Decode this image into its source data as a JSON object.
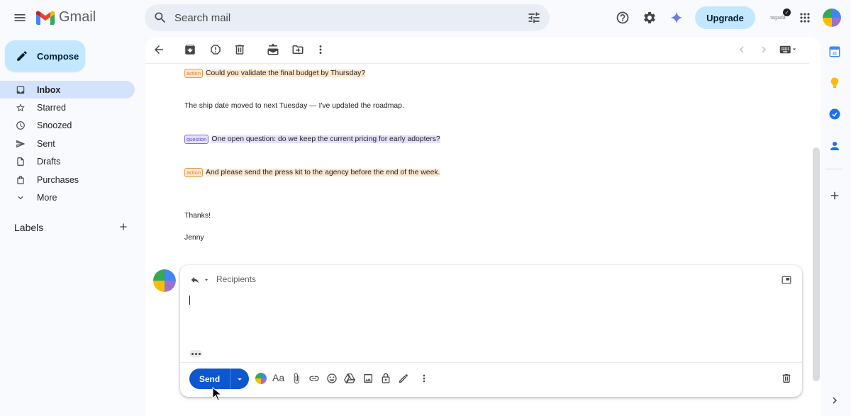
{
  "header": {
    "app_name": "Gmail",
    "search_placeholder": "Search mail",
    "upgrade_label": "Upgrade",
    "account_label": "tagada",
    "account_badge": "✓"
  },
  "compose_label": "Compose",
  "nav": {
    "items": [
      {
        "label": "Inbox",
        "icon": "inbox-icon",
        "active": true
      },
      {
        "label": "Starred",
        "icon": "star-icon"
      },
      {
        "label": "Snoozed",
        "icon": "clock-icon"
      },
      {
        "label": "Sent",
        "icon": "send-icon"
      },
      {
        "label": "Drafts",
        "icon": "draft-icon"
      },
      {
        "label": "Purchases",
        "icon": "shopping-bag-icon"
      },
      {
        "label": "More",
        "icon": "chevron-down-icon"
      }
    ],
    "labels_title": "Labels"
  },
  "message": {
    "lines": [
      {
        "tag": "action",
        "text": "Could you validate the final budget by Thursday?"
      },
      {
        "tag": "",
        "text": "The ship date moved to next Tuesday — I've updated the roadmap."
      },
      {
        "tag": "question",
        "text": "One open question: do we keep the current pricing for early adopters?"
      },
      {
        "tag": "action",
        "text": "And please send the press kit to the agency before the end of the week."
      }
    ],
    "closing": "Thanks!",
    "signature": "Jenny"
  },
  "reply": {
    "recipients_placeholder": "Recipients",
    "send_label": "Send",
    "font_label": "Aa"
  },
  "colors": {
    "accent": "#0b57d0",
    "compose_bg": "#c2e7ff",
    "active_nav": "#d3e3fd",
    "action_highlight": "#fde7cf",
    "question_highlight": "#e4e1fb"
  }
}
